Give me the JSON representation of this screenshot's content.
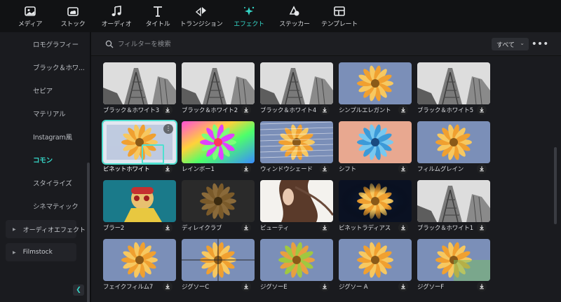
{
  "toolbar": {
    "items": [
      {
        "label": "メディア",
        "icon": "media-icon"
      },
      {
        "label": "ストック",
        "icon": "stock-cloud-icon"
      },
      {
        "label": "オーディオ",
        "icon": "music-note-icon"
      },
      {
        "label": "タイトル",
        "icon": "title-t-icon"
      },
      {
        "label": "トランジション",
        "icon": "transition-arrows-icon"
      },
      {
        "label": "エフェクト",
        "icon": "effect-sparkle-icon",
        "active": true
      },
      {
        "label": "ステッカー",
        "icon": "sticker-icon"
      },
      {
        "label": "テンプレート",
        "icon": "template-icon"
      }
    ]
  },
  "sidebar": {
    "items": [
      {
        "label": "ロモグラフィー"
      },
      {
        "label": "ブラック＆ホワ..."
      },
      {
        "label": "セピア"
      },
      {
        "label": "マテリアル"
      },
      {
        "label": "Instagram風"
      },
      {
        "label": "コモン",
        "active": true
      },
      {
        "label": "スタイライズ"
      },
      {
        "label": "シネマティック"
      }
    ],
    "groups": [
      {
        "label": "オーディオエフェクト"
      },
      {
        "label": "Filmstock"
      }
    ],
    "collapse_icon": "chevron-left-icon"
  },
  "search": {
    "placeholder": "フィルターを検索",
    "filter_value": "すべて"
  },
  "effects": [
    {
      "label": "ブラック＆ホワイト3",
      "style": "bw"
    },
    {
      "label": "ブラック＆ホワイト2",
      "style": "bw"
    },
    {
      "label": "ブラック＆ホワイト4",
      "style": "bw"
    },
    {
      "label": "シンプルエレガント",
      "style": "flower"
    },
    {
      "label": "ブラック＆ホワイト5",
      "style": "bw"
    },
    {
      "label": "ビネットホワイト",
      "style": "vignette-white",
      "selected": true
    },
    {
      "label": "レインボー1",
      "style": "rainbow"
    },
    {
      "label": "ウィンドウシェード",
      "style": "shade"
    },
    {
      "label": "シフト",
      "style": "shift"
    },
    {
      "label": "フィルムグレイン",
      "style": "flower"
    },
    {
      "label": "ブラー2",
      "style": "blur2"
    },
    {
      "label": "ディレイクラブ",
      "style": "dark"
    },
    {
      "label": "ビューティ",
      "style": "beauty"
    },
    {
      "label": "ビネットラディアス",
      "style": "radial"
    },
    {
      "label": "ブラック＆ホワイト1",
      "style": "bw"
    },
    {
      "label": "フェイクフィルム7",
      "style": "flower"
    },
    {
      "label": "ジグソーC",
      "style": "jigsaw"
    },
    {
      "label": "ジグソーE",
      "style": "jigsawg"
    },
    {
      "label": "ジグソー A",
      "style": "flower"
    },
    {
      "label": "ジグソーF",
      "style": "jigsawg2"
    }
  ]
}
